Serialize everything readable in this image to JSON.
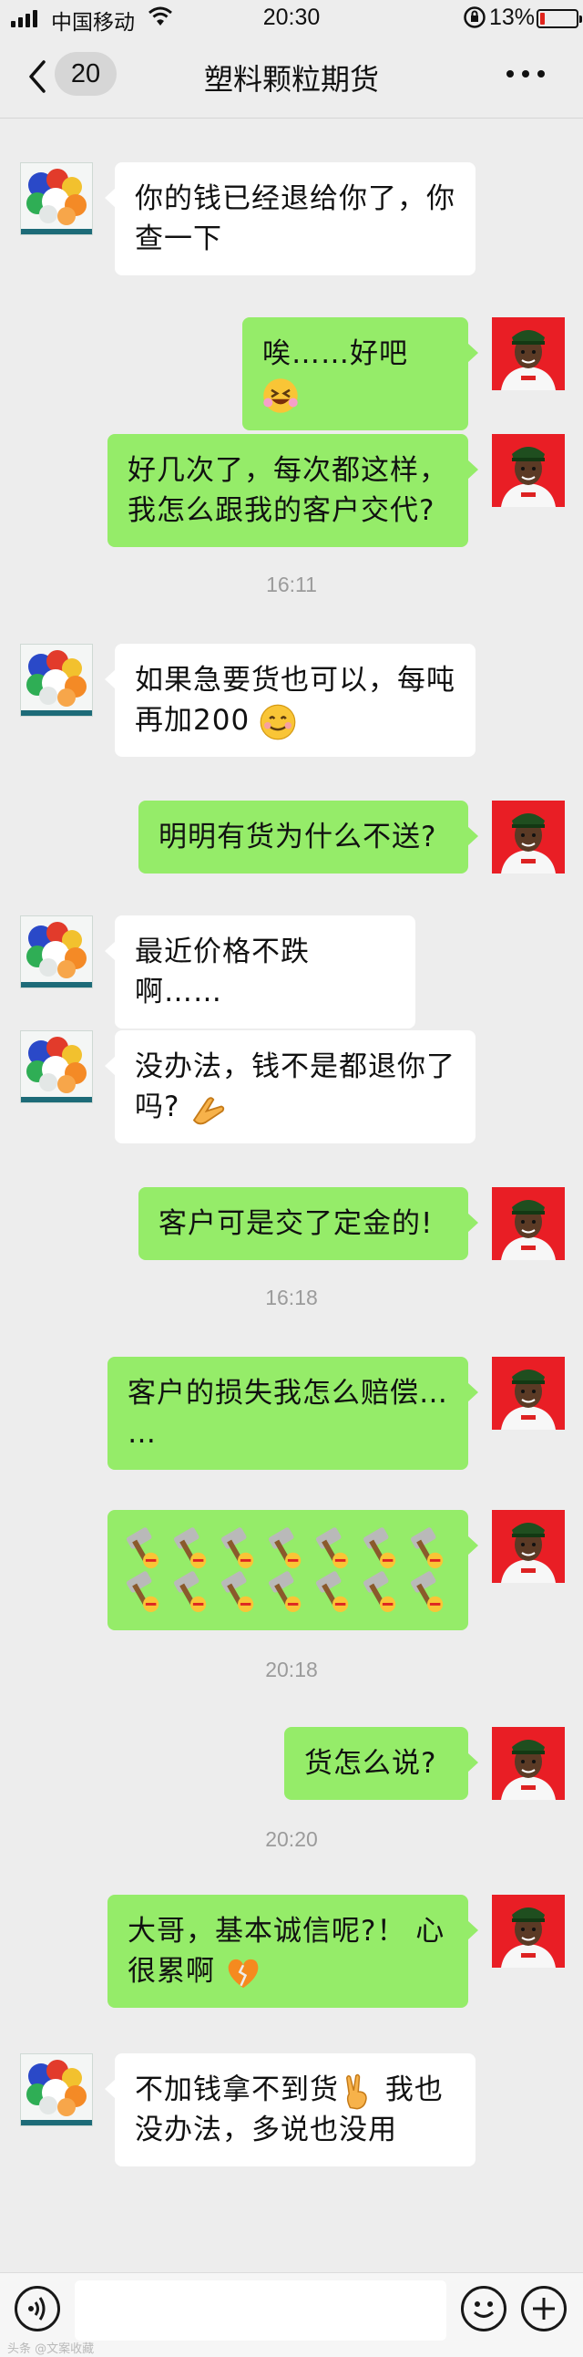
{
  "status_bar": {
    "carrier": "中国移动",
    "time": "20:30",
    "battery": "13%",
    "battery_level": 0.13
  },
  "nav": {
    "back_count": "20",
    "title": "塑料颗粒期货"
  },
  "messages": [
    {
      "side": "left",
      "line1": "你的钱已经退给你了，你",
      "line2": "查一下"
    },
    {
      "side": "right",
      "line1": "唉……好吧",
      "emoji": "grinning-squint-emoji"
    },
    {
      "side": "right",
      "line1": "好几次了，每次都这样，",
      "line2": "我怎么跟我的客户交代?"
    },
    {
      "timestamp": "16:11"
    },
    {
      "side": "left",
      "line1": "如果急要货也可以，每吨",
      "line2": "再加200",
      "emoji": "smile-emoji"
    },
    {
      "side": "right",
      "line1": "明明有货为什么不送?"
    },
    {
      "side": "left",
      "line1": "最近价格不跌啊……"
    },
    {
      "side": "left",
      "line1": "没办法，钱不是都退你了",
      "line2": "吗?",
      "emoji": "hand-gesture-emoji"
    },
    {
      "side": "right",
      "line1": "客户可是交了定金的!"
    },
    {
      "timestamp": "16:18"
    },
    {
      "side": "right",
      "line1": "客户的损失我怎么赔偿…",
      "line2": "…"
    },
    {
      "side": "right",
      "emoji_grid": "hammer-emoji",
      "emoji_count": 14
    },
    {
      "timestamp": "20:18"
    },
    {
      "side": "right",
      "line1": "货怎么说?"
    },
    {
      "timestamp": "20:20"
    },
    {
      "side": "right",
      "line1": "大哥，基本诚信呢?！ 心",
      "line2": "很累啊",
      "emoji": "broken-heart-emoji"
    },
    {
      "side": "left",
      "line1": "不加钱拿不到货",
      "emoji": "victory-hand-emoji",
      "line1b": " 我也",
      "line2": "没办法，多说也没用"
    }
  ],
  "colors": {
    "background": "#ededed",
    "bubble_self": "#95ec69",
    "bubble_other": "#ffffff"
  },
  "watermark": "头条 @文案收藏"
}
